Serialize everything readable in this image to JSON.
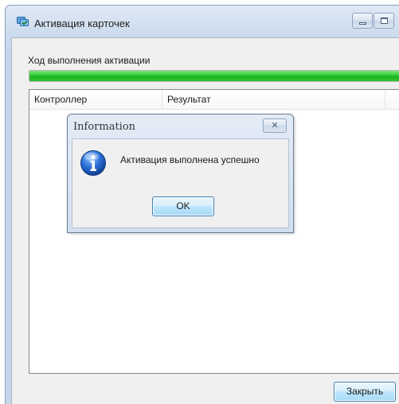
{
  "window": {
    "title": "Активация карточек",
    "icon": "card-activation-icon"
  },
  "progress": {
    "label": "Ход выполнения активации",
    "value": 1.0,
    "color": "#2ec630"
  },
  "results_table": {
    "columns": [
      "Контроллер",
      "Результат"
    ],
    "rows": []
  },
  "footer": {
    "close_label": "Закрыть"
  },
  "message_box": {
    "title": "Information",
    "icon": "information-icon",
    "message": "Активация выполнена успешно",
    "ok_label": "OK",
    "close_glyph": "✕"
  }
}
